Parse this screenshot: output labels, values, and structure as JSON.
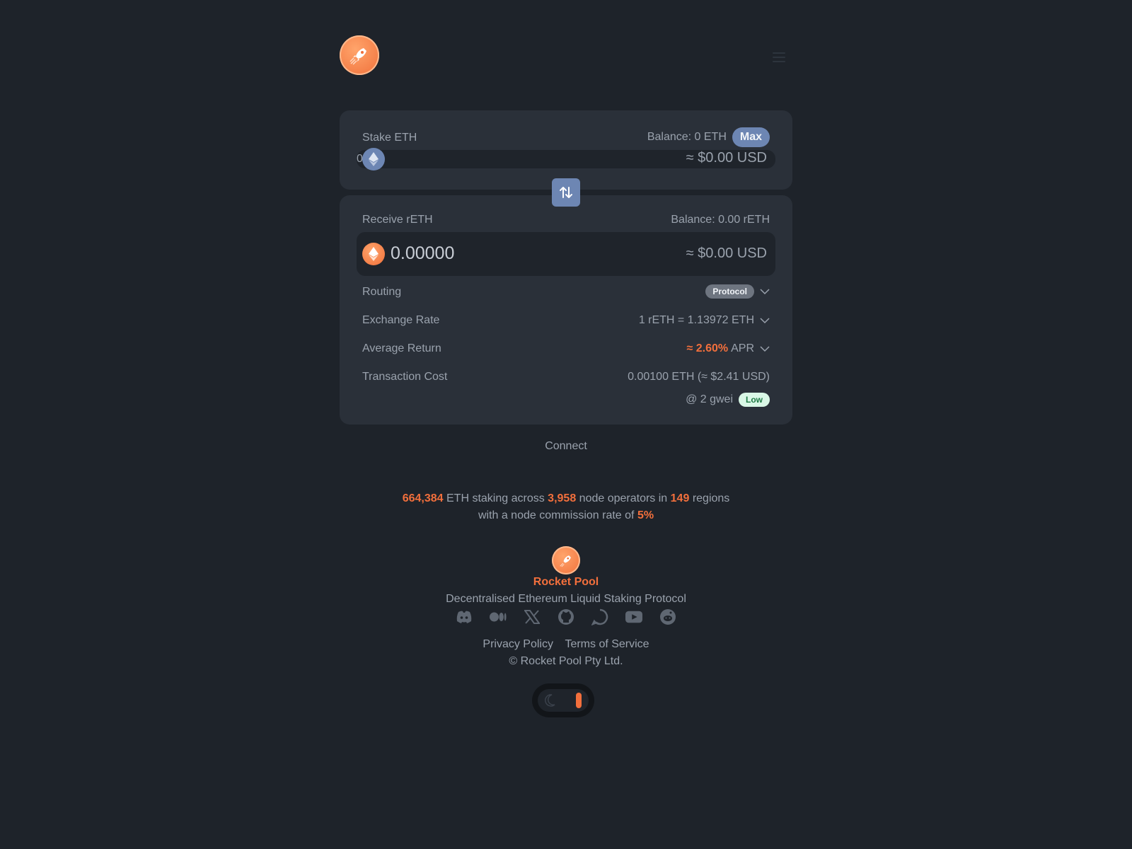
{
  "stake": {
    "label": "Stake ETH",
    "balance": "Balance: 0 ETH",
    "max_label": "Max",
    "amount": "0",
    "usd": "≈ $0.00 USD"
  },
  "receive": {
    "label": "Receive rETH",
    "balance": "Balance: 0.00 rETH",
    "amount": "0.00000",
    "usd": "≈ $0.00 USD"
  },
  "details": {
    "routing_label": "Routing",
    "routing_value": "Protocol",
    "exchange_label": "Exchange Rate",
    "exchange_value": "1 rETH = 1.13972 ETH",
    "return_label": "Average Return",
    "return_value": "≈ 2.60%",
    "return_unit": "APR",
    "cost_label": "Transaction Cost",
    "cost_value": "0.00100 ETH (≈ $2.41 USD)",
    "gas_value": "@ 2 gwei",
    "gas_badge": "Low"
  },
  "connect_label": "Connect",
  "stats": {
    "eth_staked": "664,384",
    "text1": "ETH staking across",
    "operators": "3,958",
    "text2": "node operators in",
    "regions": "149",
    "text3": "regions",
    "text4": "with a node commission rate of",
    "commission": "5%"
  },
  "footer": {
    "brand": "Rocket Pool",
    "tagline": "Decentralised Ethereum Liquid Staking Protocol",
    "privacy": "Privacy Policy",
    "terms": "Terms of Service",
    "copyright": "© Rocket Pool Pty Ltd."
  },
  "icons": [
    "rocket-icon",
    "menu-icon",
    "eth-icon",
    "swap-icon",
    "chevron-down-icon",
    "discord-icon",
    "medium-icon",
    "x-icon",
    "github-icon",
    "forum-icon",
    "youtube-icon",
    "reddit-icon",
    "moon-icon"
  ],
  "colors": {
    "background": "#1e232a",
    "card": "#2a3039",
    "accent": "#f26f3c",
    "button": "#6d86b3"
  }
}
